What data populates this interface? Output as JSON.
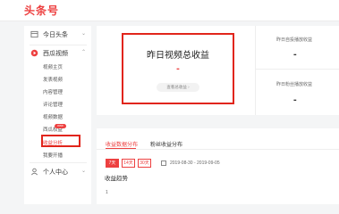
{
  "header": {
    "logo": "头条号"
  },
  "sidebar": {
    "items": [
      {
        "label": "今日头条",
        "chevron": "⌄"
      },
      {
        "label": "西瓜视频",
        "chevron": "⌃"
      }
    ],
    "sub_items": [
      "视频主页",
      "发表视频",
      "内容管理",
      "评论管理",
      "视频数据",
      "西瓜权益",
      "收益分析",
      "我要开播"
    ],
    "active_sub": "收益分析",
    "new_tag": "new",
    "personal": {
      "label": "个人中心",
      "chevron": "⌄"
    }
  },
  "overview": {
    "main_title": "昨日视频总收益",
    "main_value": "-",
    "main_pill": "查看总收益 ›",
    "stats": [
      {
        "label": "昨日自投播放收益",
        "value": "-"
      },
      {
        "label": "昨日粉丝播放收益",
        "value": "-"
      }
    ]
  },
  "analysis": {
    "tabs": [
      "收益数据分布",
      "粉丝收益分布"
    ],
    "active_tab": 0,
    "ranges": [
      "7天",
      "14天",
      "30天"
    ],
    "date_range": "2019-08-30 - 2019-09-05",
    "section_title": "收益趋势",
    "axis_tick": "1"
  },
  "colors": {
    "brand_red": "#ed4040",
    "highlight_red": "#e1251b"
  }
}
